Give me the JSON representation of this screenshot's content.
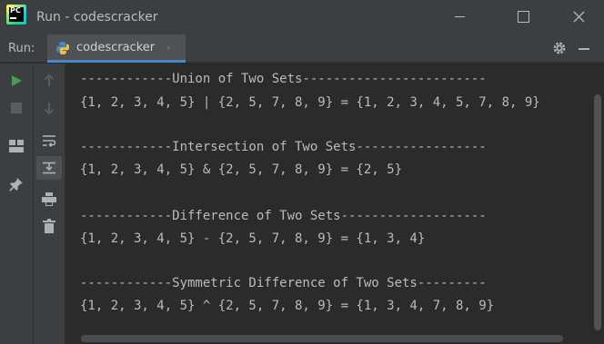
{
  "window": {
    "title": "Run - codescracker"
  },
  "run_panel": {
    "label": "Run:",
    "tab_label": "codescracker",
    "tab_close": "›"
  },
  "console": {
    "lines": [
      "------------Union of Two Sets------------------------",
      "{1, 2, 3, 4, 5} | {2, 5, 7, 8, 9} = {1, 2, 3, 4, 5, 7, 8, 9}",
      "------------Intersection of Two Sets-----------------",
      "{1, 2, 3, 4, 5} & {2, 5, 7, 8, 9} = {2, 5}",
      "------------Difference of Two Sets-------------------",
      "{1, 2, 3, 4, 5} - {2, 5, 7, 8, 9} = {1, 3, 4}",
      "------------Symmetric Difference of Two Sets---------",
      "{1, 2, 3, 4, 5} ^ {2, 5, 7, 8, 9} = {1, 3, 4, 7, 8, 9}"
    ]
  },
  "icons": {
    "left_strip": [
      "run-icon",
      "stop-icon",
      "layout-icon",
      "pin-icon"
    ],
    "tool_strip": [
      "up-arrow-icon",
      "down-arrow-icon",
      "soft-wrap-icon",
      "scroll-to-end-icon",
      "print-icon",
      "trash-icon"
    ]
  },
  "colors": {
    "accent": "#4a88c7",
    "run_green": "#499c54",
    "background": "#2b2b2b",
    "panel": "#3c3f41",
    "text": "#bbbbbb"
  }
}
